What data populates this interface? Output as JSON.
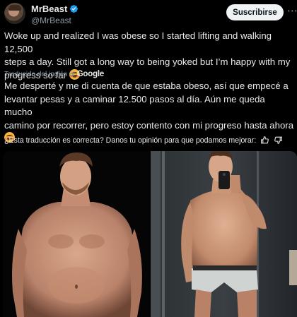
{
  "account": {
    "name": "MrBeast",
    "handle": "@MrBeast",
    "subscribe_label": "Suscribirse",
    "avatar_icon": "avatar-photo",
    "verified_icon": "verified-badge-icon",
    "more_icon": "more-options-icon"
  },
  "tweet": {
    "lines": [
      "Woke up and realized I was obese so I started lifting and walking 12,500",
      "steps a day. Still got a long way to being yoked but I’m happy with my",
      "progress so far"
    ],
    "emoji": "smiling-face-with-hearts"
  },
  "translation": {
    "label": "Traducido del inglés al",
    "provider": "Google",
    "lines": [
      "Me desperté y me di cuenta de que estaba obeso, así que empecé a",
      "levantar pesas y a caminar 12.500 pasos al día. Aún me queda mucho",
      "camino por recorrer, pero estoy contento con mi progreso hasta ahora"
    ],
    "emoji": "smiling-face-with-hearts"
  },
  "feedback": {
    "question": "¿Esta traducción es correcta? Danos tu opinión para que podamos mejorar:",
    "thumbs_up_icon": "thumbs-up-icon",
    "thumbs_down_icon": "thumbs-down-icon"
  },
  "media": {
    "images": [
      "before-photo",
      "after-mirror-selfie-photo"
    ]
  },
  "colors": {
    "background": "#000000",
    "text": "#e7e9ea",
    "muted": "#8b98a5",
    "verified": "#1d9bf0",
    "button_bg": "#eff3f4"
  }
}
